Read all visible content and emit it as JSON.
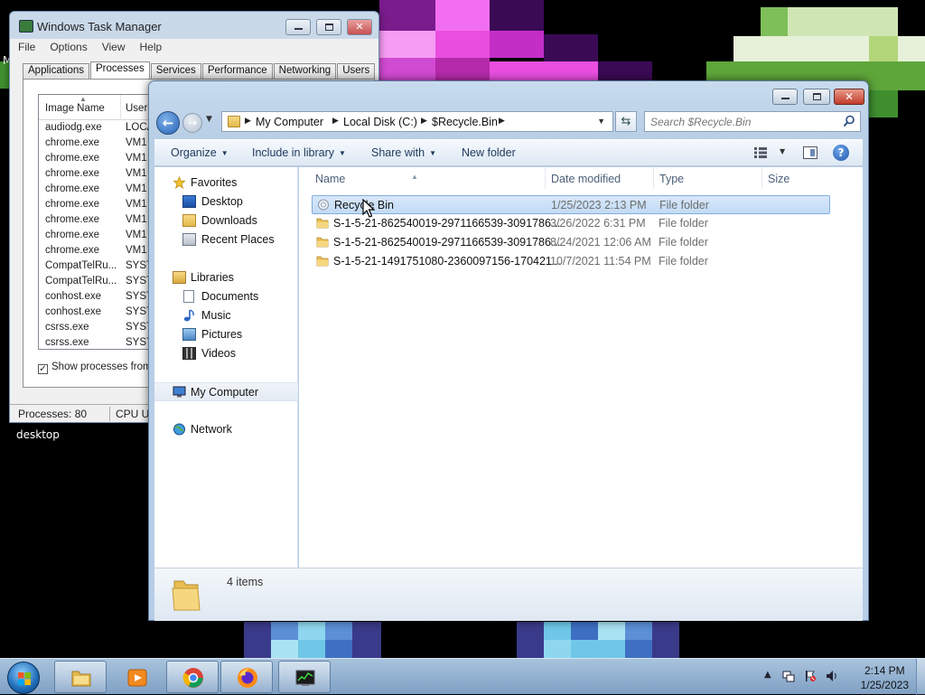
{
  "colors": {
    "desktop_magenta": "#e94ee0",
    "desktop_purple": "#4b0f6e",
    "desktop_green": "#3f8f2f",
    "desktop_cyan": "#6fc7e8",
    "explorer_frame": "#b9cfe6",
    "selection": "#cce0f8",
    "link_blue": "#1e395b"
  },
  "desktop": {
    "icon_label": "desktop",
    "edge_letter": "M"
  },
  "task_manager": {
    "title": "Windows Task Manager",
    "menu": [
      "File",
      "Options",
      "View",
      "Help"
    ],
    "tabs": [
      "Applications",
      "Processes",
      "Services",
      "Performance",
      "Networking",
      "Users"
    ],
    "active_tab": "Processes",
    "columns": {
      "image_name": "Image Name",
      "user": "User"
    },
    "processes": [
      {
        "name": "audiodg.exe",
        "user": "LOCA"
      },
      {
        "name": "chrome.exe",
        "user": "VM1"
      },
      {
        "name": "chrome.exe",
        "user": "VM1"
      },
      {
        "name": "chrome.exe",
        "user": "VM1"
      },
      {
        "name": "chrome.exe",
        "user": "VM1"
      },
      {
        "name": "chrome.exe",
        "user": "VM1"
      },
      {
        "name": "chrome.exe",
        "user": "VM1"
      },
      {
        "name": "chrome.exe",
        "user": "VM1"
      },
      {
        "name": "chrome.exe",
        "user": "VM1"
      },
      {
        "name": "CompatTelRu...",
        "user": "SYST"
      },
      {
        "name": "CompatTelRu...",
        "user": "SYST"
      },
      {
        "name": "conhost.exe",
        "user": "SYST"
      },
      {
        "name": "conhost.exe",
        "user": "SYST"
      },
      {
        "name": "csrss.exe",
        "user": "SYST"
      },
      {
        "name": "csrss.exe",
        "user": "SYST"
      }
    ],
    "show_all_label": "Show processes from",
    "show_all_checked": "✓",
    "status_processes": "Processes: 80",
    "status_cpu": "CPU Us"
  },
  "explorer": {
    "breadcrumb": [
      "My Computer",
      "Local Disk (C:)",
      "$Recycle.Bin"
    ],
    "search_placeholder": "Search $Recycle.Bin",
    "toolbar": {
      "organize": "Organize",
      "include_in_library": "Include in library",
      "share_with": "Share with",
      "new_folder": "New folder"
    },
    "nav": {
      "favorites": "Favorites",
      "favorite_items": [
        "Desktop",
        "Downloads",
        "Recent Places"
      ],
      "libraries": "Libraries",
      "library_items": [
        "Documents",
        "Music",
        "Pictures",
        "Videos"
      ],
      "computer": "My Computer",
      "network": "Network"
    },
    "columns": {
      "name": "Name",
      "date": "Date modified",
      "type": "Type",
      "size": "Size"
    },
    "files": [
      {
        "name": "Recycle Bin",
        "date": "1/25/2023 2:13 PM",
        "type": "File folder",
        "icon": "recycle-bin-icon"
      },
      {
        "name": "S-1-5-21-862540019-2971166539-3091786...",
        "date": "3/26/2022 6:31 PM",
        "type": "File folder",
        "icon": "folder-icon"
      },
      {
        "name": "S-1-5-21-862540019-2971166539-3091786...",
        "date": "8/24/2021 12:06 AM",
        "type": "File folder",
        "icon": "folder-icon"
      },
      {
        "name": "S-1-5-21-1491751080-2360097156-170421...",
        "date": "10/7/2021 11:54 PM",
        "type": "File folder",
        "icon": "folder-icon"
      }
    ],
    "selected_index": 0,
    "item_count": "4 items"
  },
  "taskbar": {
    "apps": [
      "explorer-icon",
      "media-player-icon",
      "chrome-icon",
      "firefox-icon",
      "task-manager-icon"
    ],
    "time": "2:14 PM",
    "date": "1/25/2023",
    "tray_expand": "▲"
  }
}
